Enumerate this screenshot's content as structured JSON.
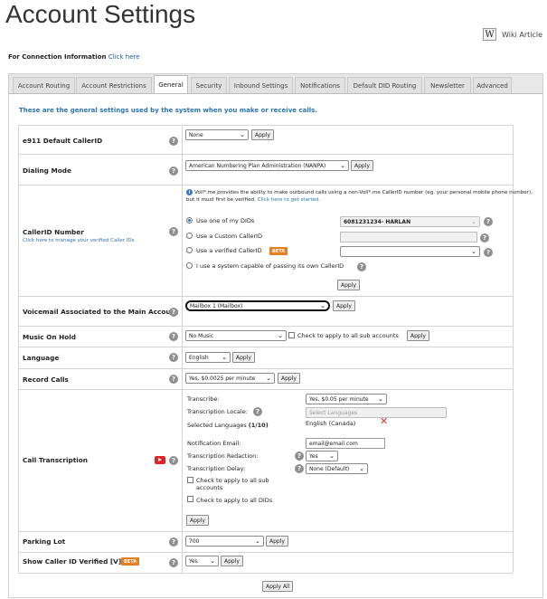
{
  "page": {
    "title": "Account Settings",
    "wiki_label": "Wiki Article",
    "wiki_icon": "W",
    "connection_label": "For Connection Information",
    "connection_link": "Click here",
    "intro": "These are the general settings used by the system when you make or receive calls."
  },
  "tabs": [
    {
      "label": "Account Routing"
    },
    {
      "label": "Account Restrictions"
    },
    {
      "label": "General",
      "active": true
    },
    {
      "label": "Security"
    },
    {
      "label": "Inbound Settings"
    },
    {
      "label": "Notifications"
    },
    {
      "label": "Default DID Routing"
    },
    {
      "label": "Newsletter"
    },
    {
      "label": "Advanced"
    }
  ],
  "common": {
    "apply": "Apply",
    "apply_all": "Apply All",
    "help": "?",
    "beta": "BETA"
  },
  "e911": {
    "label": "e911 Default CallerID",
    "value": "None"
  },
  "dialing": {
    "label": "Dialing Mode",
    "value": "American Numbering Plan Administration (NANPA)"
  },
  "callerid": {
    "label": "CallerID Number",
    "sublabel": "Click here to manage your verified Caller IDs",
    "note_text": "Voll*.me provides the ability to make outbound calls using a non-Voll*.me CallerID number (eg. your personal mobile phone number), but it must first be verified.",
    "note_link": "Click here to get started.",
    "opt_my_dids": "Use one of my DIDs",
    "my_did_value": "6081231234- HARLAN",
    "opt_custom": "Use a Custom CallerID",
    "opt_verified": "Use a verified CallerID",
    "opt_system": "I use a system capable of passing its own CallerID"
  },
  "voicemail": {
    "label": "Voicemail Associated to the Main Account",
    "value": "Mailbox 1 (Mailbox)"
  },
  "moh": {
    "label": "Music On Hold",
    "value": "No Music",
    "check_label": "Check to apply to all sub accounts"
  },
  "language": {
    "label": "Language",
    "value": "English"
  },
  "record": {
    "label": "Record Calls",
    "value": "Yes, $0.0025 per minute"
  },
  "transcription": {
    "label": "Call Transcription",
    "transcribe_label": "Transcribe:",
    "transcribe_value": "Yes, $0.05 per minute",
    "locale_label": "Transcription Locale:",
    "locale_placeholder": "Select Languages",
    "selected_label": "Selected Languages",
    "selected_count": "(1/10)",
    "selected_value": "English (Canada)",
    "email_label": "Notification Email:",
    "email_value": "email@email.com",
    "redaction_label": "Transcription Redaction:",
    "redaction_value": "Yes",
    "delay_label": "Transcription Delay:",
    "delay_value": "None (Default)",
    "check_sub": "Check to apply to all sub accounts",
    "check_dids": "Check to apply to all DIDs"
  },
  "parking": {
    "label": "Parking Lot",
    "value": "700"
  },
  "show_cid": {
    "label": "Show Caller ID Verified [V]",
    "value": "Yes"
  },
  "colors": {
    "link": "#2a73b0",
    "beta": "#e67e22",
    "youtube": "#e02424"
  }
}
